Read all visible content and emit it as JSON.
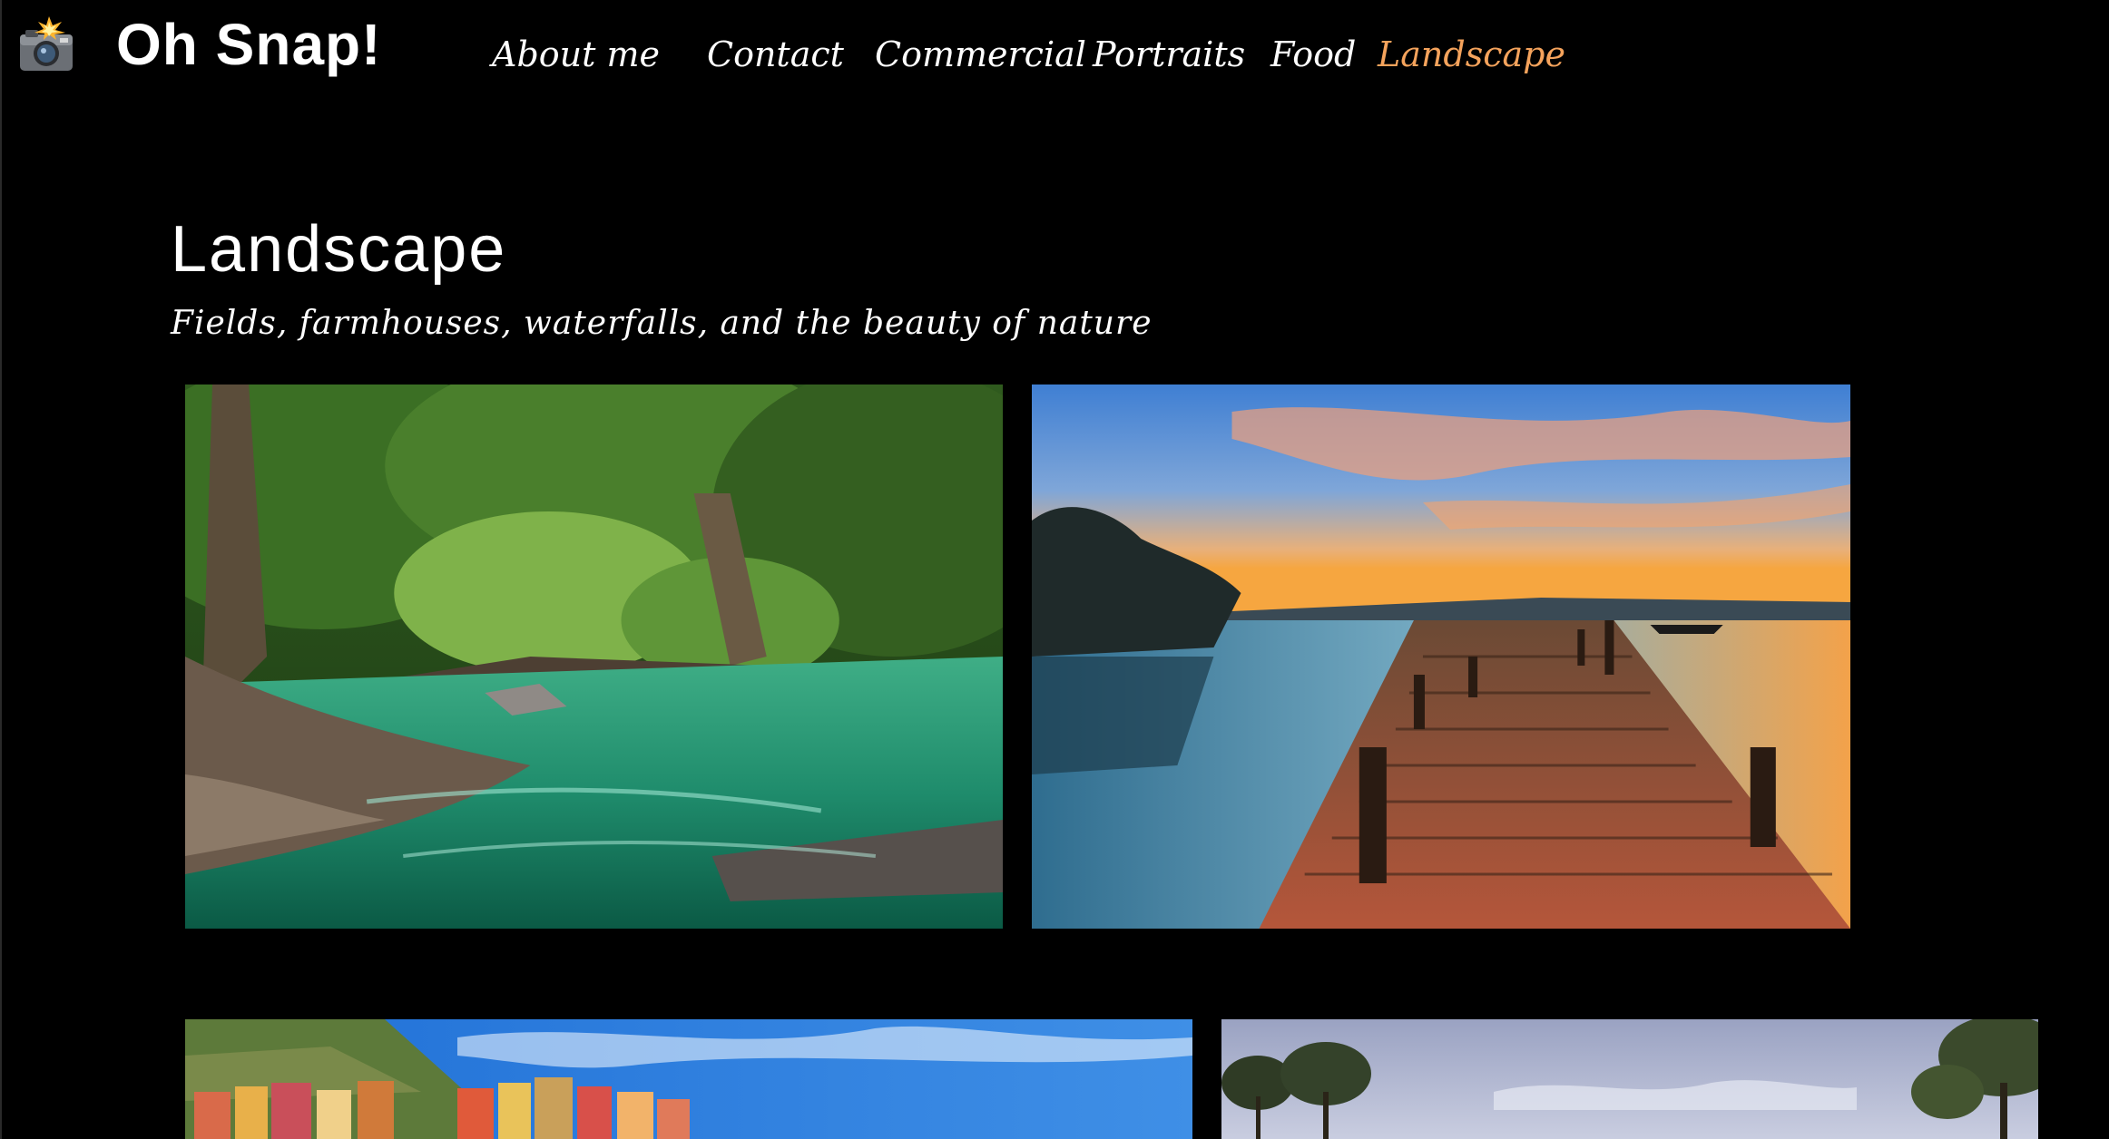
{
  "brand": {
    "name": "Oh Snap!",
    "logo_icon": "camera-flash-icon"
  },
  "nav": {
    "items": [
      {
        "label": "About me"
      },
      {
        "label": "Contact"
      },
      {
        "label": "Commercial"
      },
      {
        "label": "Portraits"
      },
      {
        "label": "Food"
      },
      {
        "label": "Landscape",
        "active": true
      }
    ],
    "active_color": "#f5a35c"
  },
  "page": {
    "title": "Landscape",
    "subtitle": "Fields, farmhouses, waterfalls, and the beauty of nature"
  },
  "gallery": {
    "photos": [
      {
        "subject": "forest-river-photo"
      },
      {
        "subject": "lake-jetty-sunset-photo"
      },
      {
        "subject": "coastal-village-photo"
      },
      {
        "subject": "trees-sky-photo"
      }
    ]
  },
  "colors": {
    "background": "#000000",
    "text": "#ffffff",
    "accent": "#f5a35c"
  }
}
